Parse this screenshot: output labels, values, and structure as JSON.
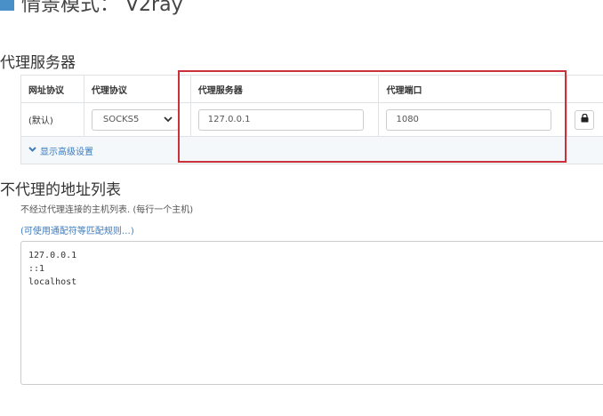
{
  "profile": {
    "title": "情景模式： V2ray"
  },
  "proxy_section": {
    "heading": "代理服务器",
    "columns": {
      "scheme": "网址协议",
      "protocol": "代理协议",
      "server": "代理服务器",
      "port": "代理端口"
    },
    "row": {
      "scheme": "(默认)",
      "protocol": "SOCKS5",
      "server": "127.0.0.1",
      "port": "1080"
    },
    "advanced_label": "显示高级设置",
    "icons": {
      "protocol_dropdown": "chevron-down-icon",
      "auth": "lock-icon",
      "advanced": "caret-down-icon"
    }
  },
  "bypass_section": {
    "heading": "不代理的地址列表",
    "description": "不经过代理连接的主机列表. (每行一个主机)",
    "wildcard_link": "(可使用通配符等匹配规则…)",
    "entries": [
      "127.0.0.1",
      "::1",
      "localhost"
    ]
  },
  "colors": {
    "accent": "#3b7bbf",
    "highlight": "#c9323a",
    "title_icon": "#4a90c8"
  }
}
